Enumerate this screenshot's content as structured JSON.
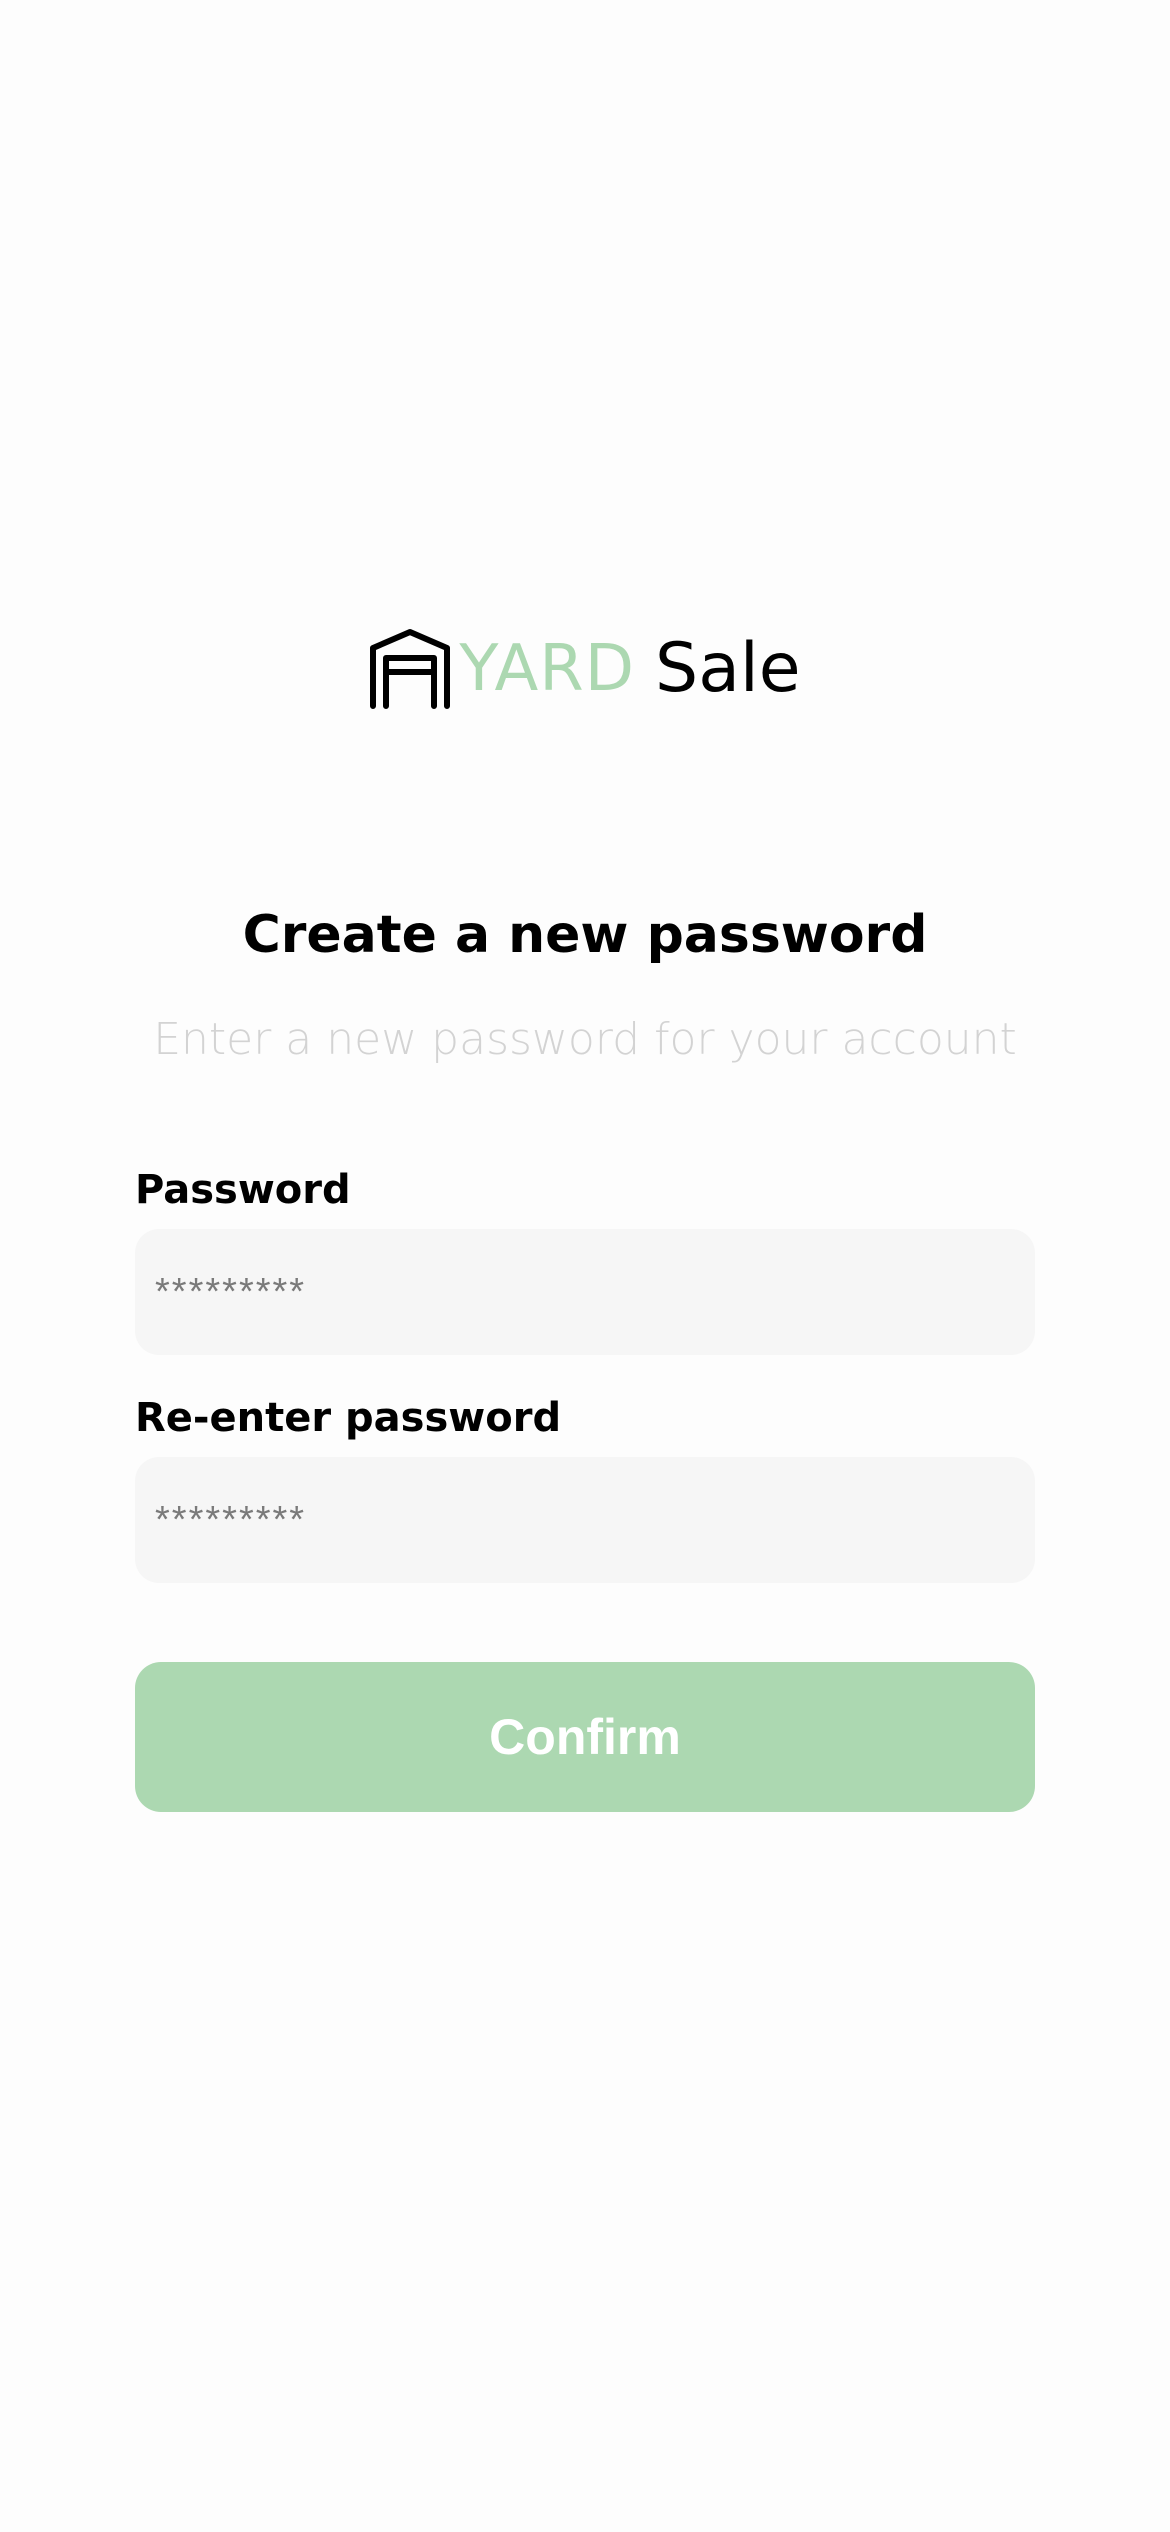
{
  "colors": {
    "brand_green": "#acd8b1",
    "background": "#fdfdfd",
    "input_background": "#f6f6f6",
    "subtitle_gray": "#d3d3d3"
  },
  "logo": {
    "icon": "garage-icon",
    "brand_yard": "YARD",
    "brand_sale": "Sale"
  },
  "header": {
    "title": "Create a new password",
    "subtitle": "Enter a new password for your account"
  },
  "form": {
    "password": {
      "label": "Password",
      "placeholder": "*********",
      "value": ""
    },
    "confirm_password": {
      "label": "Re-enter password",
      "placeholder": "*********",
      "value": ""
    },
    "submit_label": "Confirm"
  }
}
